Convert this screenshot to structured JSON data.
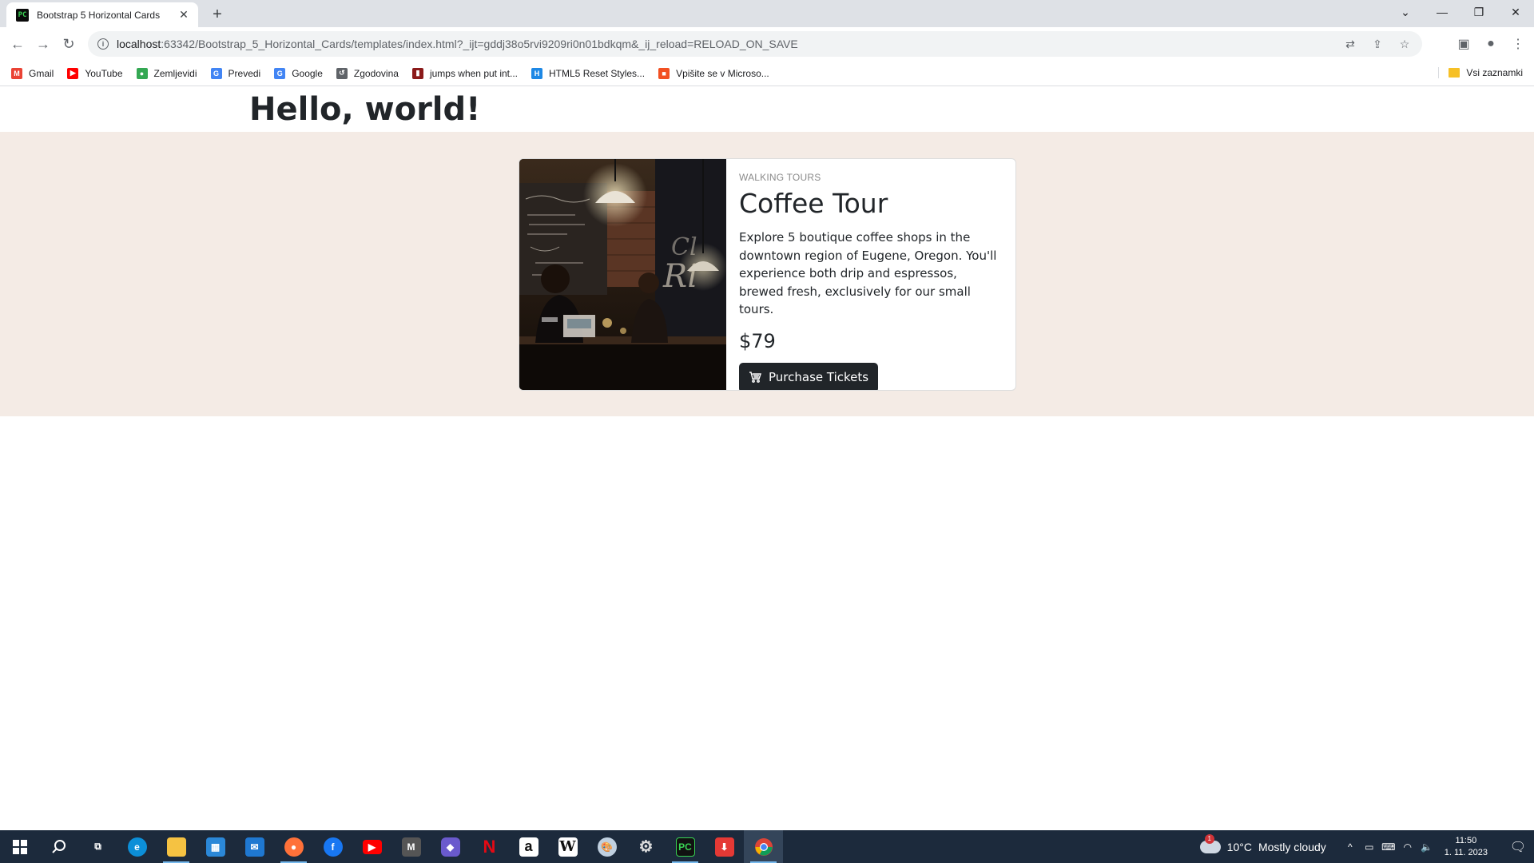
{
  "browser": {
    "tab_title": "Bootstrap 5 Horizontal Cards",
    "tab_favicon": "PC",
    "url_host": "localhost",
    "url_rest": ":63342/Bootstrap_5_Horizontal_Cards/templates/index.html?_ijt=gddj38o5rvi9209ri0n01bdkqm&_ij_reload=RELOAD_ON_SAVE",
    "bookmarks": [
      {
        "label": "Gmail",
        "icon": "gmail-icon",
        "color": "#ea4335",
        "glyph": "M"
      },
      {
        "label": "YouTube",
        "icon": "youtube-icon",
        "color": "#ff0000",
        "glyph": "▶"
      },
      {
        "label": "Zemljevidi",
        "icon": "maps-icon",
        "color": "#34a853",
        "glyph": "●"
      },
      {
        "label": "Prevedi",
        "icon": "translate-icon",
        "color": "#4285f4",
        "glyph": "G"
      },
      {
        "label": "Google",
        "icon": "google-icon",
        "color": "#4285f4",
        "glyph": "G"
      },
      {
        "label": "Zgodovina",
        "icon": "history-icon",
        "color": "#5f6368",
        "glyph": "↺"
      },
      {
        "label": "jumps when put int...",
        "icon": "stackoverflow-icon",
        "color": "#8b1a1a",
        "glyph": "▮"
      },
      {
        "label": "HTML5 Reset Styles...",
        "icon": "html5-icon",
        "color": "#1e88e5",
        "glyph": "H"
      },
      {
        "label": "Vpišite se v Microso...",
        "icon": "microsoft-icon",
        "color": "#f25022",
        "glyph": "■"
      }
    ],
    "all_bookmarks_label": "Vsi zaznamki"
  },
  "page": {
    "heading": "Hello, world!"
  },
  "card": {
    "eyebrow": "WALKING TOURS",
    "title": "Coffee Tour",
    "text": "Explore 5 boutique coffee shops in the downtown region of Eugene, Oregon. You'll experience both drip and espressos, brewed fresh, exclusively for our small tours.",
    "price": "$79",
    "button_label": "Purchase Tickets",
    "image_alt": "coffee-shop-photo"
  },
  "taskbar": {
    "weather_temp": "10°C",
    "weather_desc": "Mostly cloudy",
    "weather_badge": "1",
    "time": "11:50",
    "date": "1. 11. 2023"
  }
}
